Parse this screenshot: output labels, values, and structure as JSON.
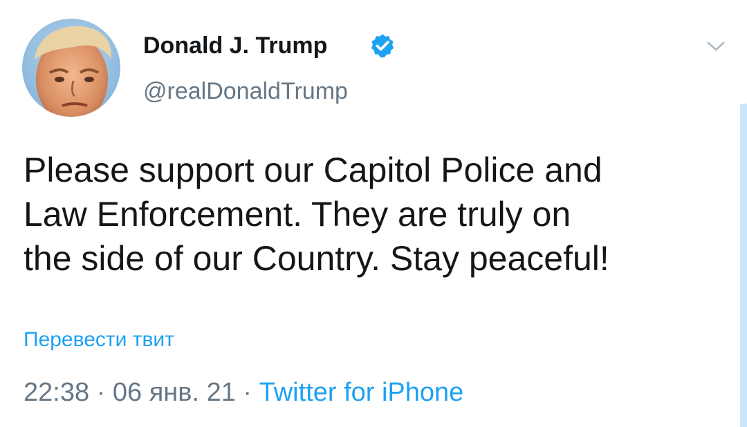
{
  "author": {
    "display_name": "Donald J. Trump",
    "handle": "@realDonaldTrump",
    "verified": true,
    "avatar_icon": "profile-photo"
  },
  "menu": {
    "icon": "chevron-down-icon"
  },
  "tweet": {
    "lines": [
      "Please support our Capitol Police and",
      "Law Enforcement. They are truly on",
      "the side of our Country. Stay peaceful!"
    ]
  },
  "translate": {
    "label": "Перевести твит"
  },
  "meta": {
    "time": "22:38",
    "separator": "·",
    "date": "06 янв. 21",
    "source": "Twitter for iPhone"
  },
  "colors": {
    "accent": "#1da1f2",
    "text": "#14171a",
    "secondary": "#657786"
  }
}
